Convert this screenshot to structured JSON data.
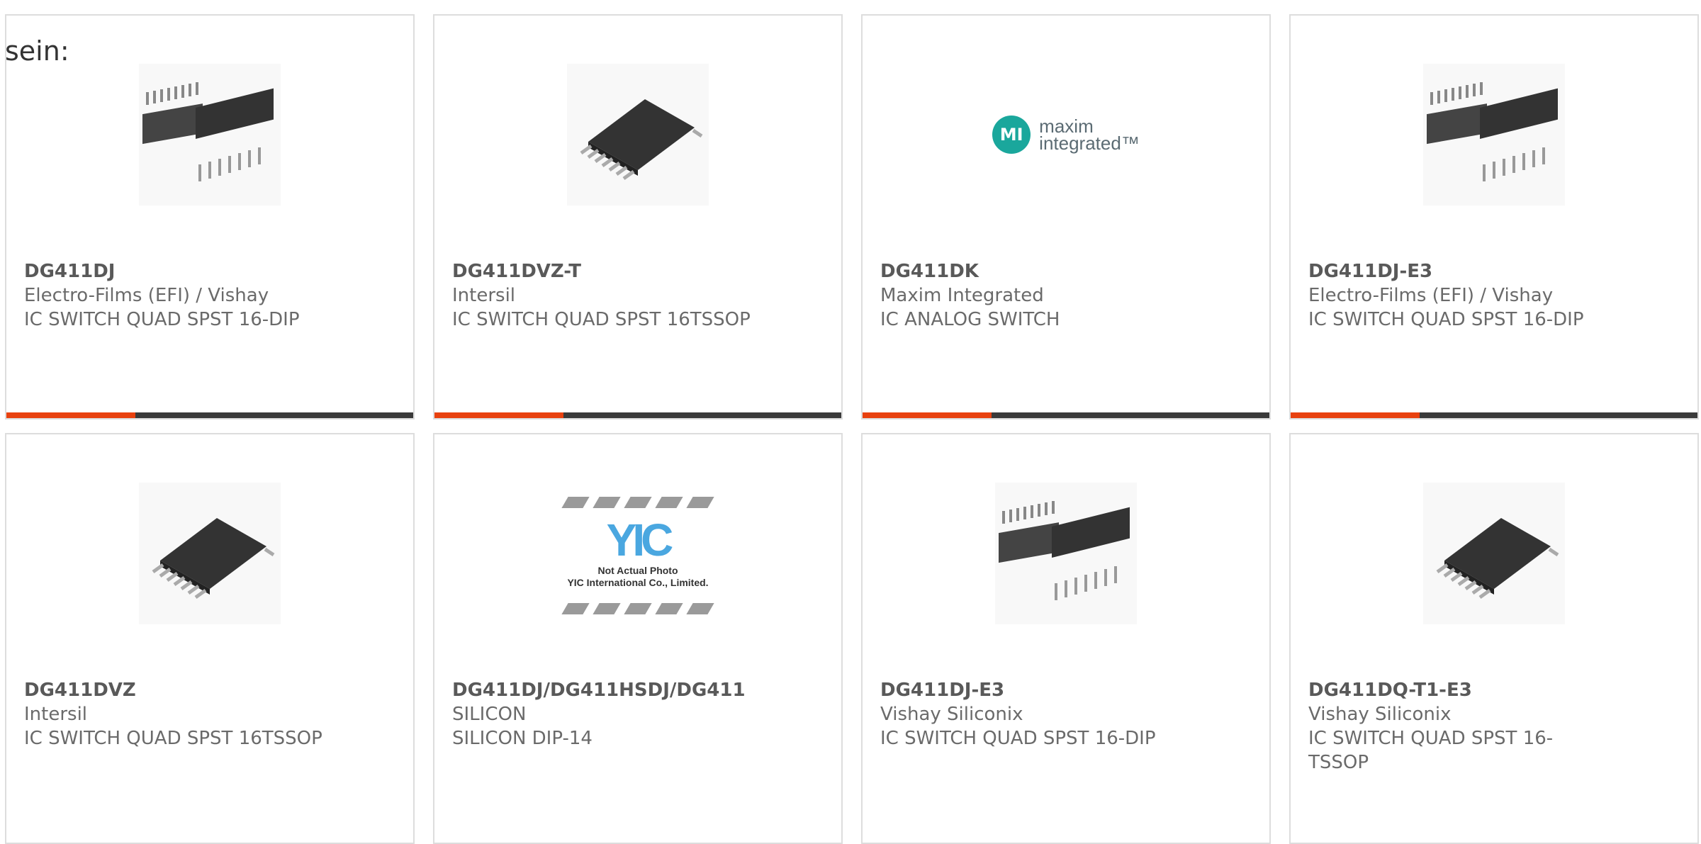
{
  "intro_text": "sein:",
  "colors": {
    "accent": "#e8410f",
    "bar": "#3a3a3a",
    "text": "#6a6a6a",
    "border": "#dddddd",
    "maxim_teal": "#1aa79c",
    "yic_blue": "#4aa7e0"
  },
  "products": [
    {
      "part": "DG411DJ",
      "maker": "Electro-Films (EFI) / Vishay",
      "desc": "IC SWITCH QUAD SPST 16-DIP",
      "image": "dip-package-icon"
    },
    {
      "part": "DG411DVZ-T",
      "maker": "Intersil",
      "desc": "IC SWITCH QUAD SPST 16TSSOP",
      "image": "tssop-package-icon"
    },
    {
      "part": "DG411DK",
      "maker": "Maxim Integrated",
      "desc": "IC ANALOG SWITCH",
      "image": "maxim-logo",
      "logo_mark": "MI",
      "logo_line1": "maxim",
      "logo_line2": "integrated™"
    },
    {
      "part": "DG411DJ-E3",
      "maker": "Electro-Films (EFI) / Vishay",
      "desc": "IC SWITCH QUAD SPST 16-DIP",
      "image": "dip-package-icon"
    },
    {
      "part": "DG411DVZ",
      "maker": "Intersil",
      "desc": "IC SWITCH QUAD SPST 16TSSOP",
      "image": "tssop-package-icon"
    },
    {
      "part": "DG411DJ/DG411HSDJ/DG411",
      "maker": "SILICON",
      "desc": "SILICON DIP-14",
      "image": "yic-placeholder",
      "logo_text": "YIC",
      "photo_note_1": "Not Actual Photo",
      "photo_note_2": "YIC International Co., Limited."
    },
    {
      "part": "DG411DJ-E3",
      "maker": "Vishay Siliconix",
      "desc": "IC SWITCH QUAD SPST 16-DIP",
      "image": "dip-package-icon"
    },
    {
      "part": "DG411DQ-T1-E3",
      "maker": "Vishay Siliconix",
      "desc": "IC SWITCH QUAD SPST 16-TSSOP",
      "image": "tssop-package-icon"
    }
  ]
}
